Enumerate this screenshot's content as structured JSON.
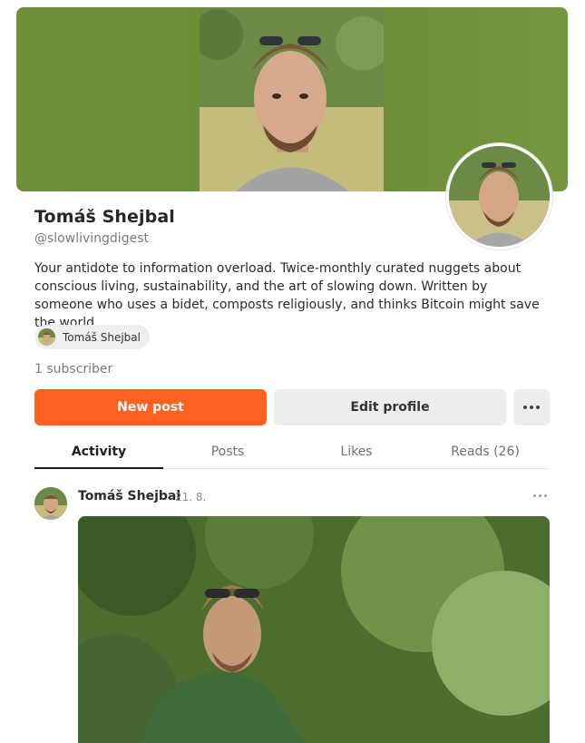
{
  "profile": {
    "name": "Tomáš Shejbal",
    "handle": "@slowlivingdigest",
    "bio": "Your antidote to information overload. Twice-monthly curated nuggets about conscious living, sustainability, and the art of slowing down. Written by someone who uses a bidet, composts religiously, and thinks Bitcoin might save the world.",
    "chip_name": "Tomáš Shejbal",
    "subscribers": "1 subscriber"
  },
  "actions": {
    "new_post": "New post",
    "edit_profile": "Edit profile",
    "more_icon": "more-horizontal-icon"
  },
  "tabs": [
    {
      "label": "Activity",
      "active": true
    },
    {
      "label": "Posts",
      "active": false
    },
    {
      "label": "Likes",
      "active": false
    },
    {
      "label": "Reads (26)",
      "active": false
    }
  ],
  "post": {
    "author": "Tomáš Shejbal",
    "date": "21. 8.",
    "more_icon": "more-horizontal-icon"
  },
  "colors": {
    "accent": "#ff6121",
    "banner": "#6f8f38"
  }
}
